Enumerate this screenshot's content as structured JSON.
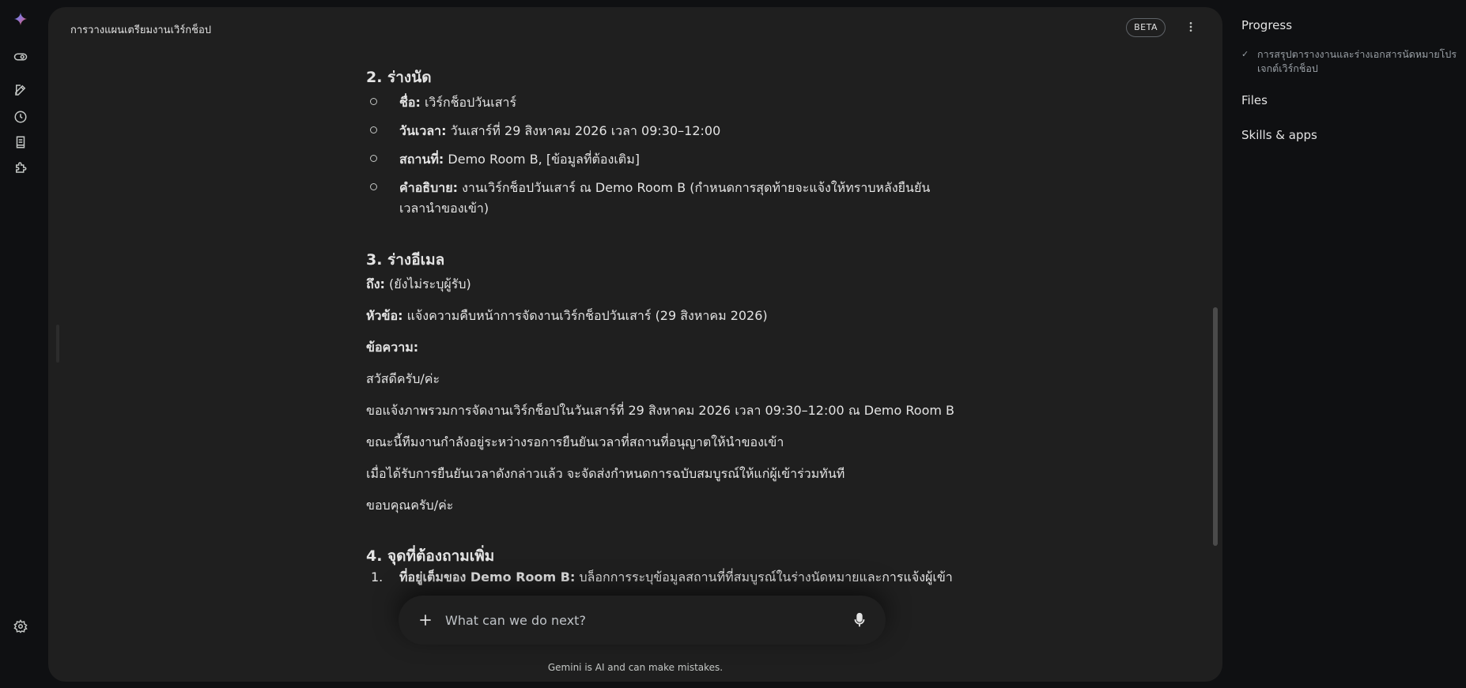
{
  "app": {
    "chat_title": "การวางแผนเตรียมงานเวิร์กช็อป",
    "beta_badge": "BETA"
  },
  "rail": {
    "icons": [
      "gemini-logo-icon",
      "toggle-icon",
      "new-chat-icon",
      "history-icon",
      "notebook-icon",
      "extensions-icon",
      "settings-icon"
    ]
  },
  "content": {
    "section2": {
      "heading": "2. ร่างนัด",
      "items": [
        {
          "label": "ชื่อ:",
          "value": " เวิร์กช็อปวันเสาร์"
        },
        {
          "label": "วันเวลา:",
          "value": " วันเสาร์ที่ 29 สิงหาคม 2026 เวลา 09:30–12:00"
        },
        {
          "label": "สถานที่:",
          "value": " Demo Room B, [ข้อมูลที่ต้องเติม]"
        },
        {
          "label": "คำอธิบาย:",
          "value": " งานเวิร์กช็อปวันเสาร์ ณ Demo Room B (กำหนดการสุดท้ายจะแจ้งให้ทราบหลังยืนยันเวลานำของเข้า)"
        }
      ]
    },
    "section3": {
      "heading": "3. ร่างอีเมล",
      "to_label": "ถึง:",
      "to_value": " (ยังไม่ระบุผู้รับ)",
      "subject_label": "หัวข้อ:",
      "subject_value": " แจ้งความคืบหน้าการจัดงานเวิร์กช็อปวันเสาร์ (29 สิงหาคม 2026)",
      "message_label": "ข้อความ:",
      "greeting": "สวัสดีครับ/ค่ะ",
      "line1": "ขอแจ้งภาพรวมการจัดงานเวิร์กช็อปในวันเสาร์ที่ 29 สิงหาคม 2026 เวลา 09:30–12:00 ณ Demo Room B",
      "line2": "ขณะนี้ทีมงานกำลังอยู่ระหว่างรอการยืนยันเวลาที่สถานที่อนุญาตให้นำของเข้า",
      "line3": "เมื่อได้รับการยืนยันเวลาดังกล่าวแล้ว จะจัดส่งกำหนดการฉบับสมบูรณ์ให้แก่ผู้เข้าร่วมทันที",
      "closing": "ขอบคุณครับ/ค่ะ"
    },
    "section4": {
      "heading": "4. จุดที่ต้องถามเพิ่ม",
      "item1_number": "1.",
      "item1_label": "ที่อยู่เต็มของ Demo Room B:",
      "item1_value": " บล็อกการระบุข้อมูลสถานที่ที่สมบูรณ์ในร่างนัดหมายและการแจ้งผู้เข้า"
    }
  },
  "input": {
    "placeholder": "What can we do next?"
  },
  "footer": {
    "disclaimer": "Gemini is AI and can make mistakes."
  },
  "side_panel": {
    "progress_heading": "Progress",
    "progress_item": "การสรุปตารางงานและร่างเอกสารนัดหมายโปรเจกต์เวิร์กช็อป",
    "files_heading": "Files",
    "skills_heading": "Skills & apps"
  }
}
